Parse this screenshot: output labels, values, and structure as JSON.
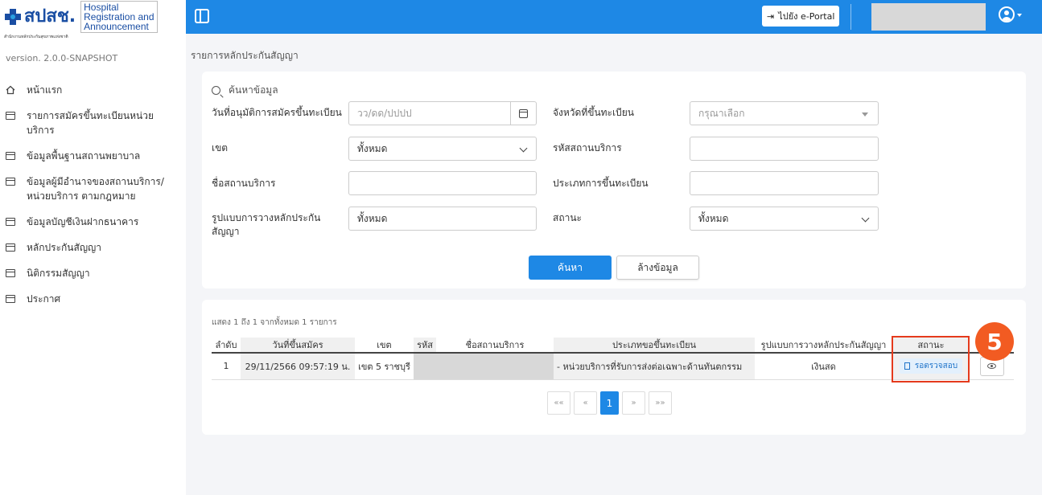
{
  "brand": {
    "logo_text": "สปสช.",
    "logo_subtext": "สำนักงานหลักประกันสุขภาพแห่งชาติ",
    "app_name_line1": "Hospital",
    "app_name_line2": "Registration and",
    "app_name_line3": "Announcement",
    "version": "version. 2.0.0-SNAPSHOT"
  },
  "sidebar": {
    "items": [
      {
        "label": "หน้าแรก",
        "icon": "home-icon"
      },
      {
        "label": "รายการสมัครขึ้นทะเบียนหน่วยบริการ",
        "icon": "list-icon"
      },
      {
        "label": "ข้อมูลพื้นฐานสถานพยาบาล",
        "icon": "list-icon"
      },
      {
        "label": "ข้อมูลผู้มีอำนาจของสถานบริการ/หน่วยบริการ ตามกฎหมาย",
        "icon": "list-icon"
      },
      {
        "label": "ข้อมูลบัญชีเงินฝากธนาคาร",
        "icon": "list-icon"
      },
      {
        "label": "หลักประกันสัญญา",
        "icon": "list-icon"
      },
      {
        "label": "นิติกรรมสัญญา",
        "icon": "list-icon"
      },
      {
        "label": "ประกาศ",
        "icon": "list-icon"
      }
    ]
  },
  "header": {
    "eportal_label": "ไปยัง e-Portal",
    "header_color": "#1e88e5"
  },
  "page": {
    "breadcrumb": "รายการหลักประกันสัญญา"
  },
  "search": {
    "title": "ค้นหาข้อมูล",
    "approve_date_label": "วันที่อนุมัติการสมัครขึ้นทะเบียน",
    "approve_date_placeholder": "วว/ดด/ปปปป",
    "province_label": "จังหวัดที่ขึ้นทะเบียน",
    "province_placeholder": "กรุณาเลือก",
    "zone_label": "เขต",
    "zone_value": "ทั้งหมด",
    "service_code_label": "รหัสสถานบริการ",
    "service_code_value": "",
    "service_name_label": "ชื่อสถานบริการ",
    "service_name_value": "",
    "reg_type_label": "ประเภทการขึ้นทะเบียน",
    "reg_type_value": "",
    "collateral_type_label": "รูปแบบการวางหลักประกันสัญญา",
    "collateral_type_value": "ทั้งหมด",
    "status_label": "สถานะ",
    "status_value": "ทั้งหมด",
    "search_button": "ค้นหา",
    "clear_button": "ล้างข้อมูล"
  },
  "results": {
    "showing": "แสดง 1 ถึง 1 จากทั้งหมด 1 รายการ",
    "columns": [
      "ลำดับ",
      "วันที่ขึ้นสมัคร",
      "เขต",
      "รหัส",
      "ชื่อสถานบริการ",
      "ประเภทขอขึ้นทะเบียน",
      "รูปแบบการวางหลักประกันสัญญา",
      "สถานะ",
      ""
    ],
    "rows": [
      {
        "no": "1",
        "date": "29/11/2566 09:57:19 น.",
        "zone": "เขต 5 ราชบุรี",
        "code": "",
        "name": "",
        "reg_type": "- หน่วยบริการที่รับการส่งต่อเฉพาะด้านทันตกรรม",
        "collateral": "เงินสด",
        "status": "รอตรวจสอบ"
      }
    ],
    "pager": {
      "first": "««",
      "prev": "«",
      "current": "1",
      "next": "»",
      "last": "»»"
    }
  },
  "annotation": {
    "step_number": "5",
    "highlight_color": "#e53a1c",
    "badge_color": "#f25b22"
  }
}
